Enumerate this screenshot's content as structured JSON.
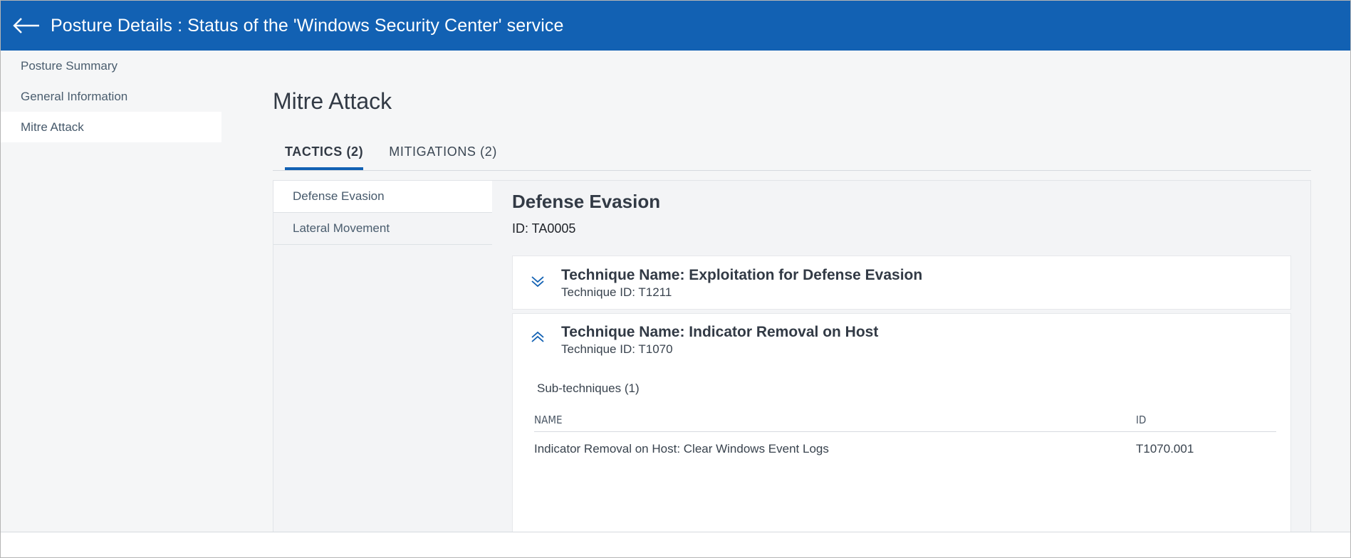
{
  "header": {
    "title": "Posture Details : Status of the 'Windows Security Center' service",
    "back_icon": "arrow-left-icon",
    "bg_color": "#1261b3"
  },
  "sidebar": {
    "items": [
      {
        "label": "Posture Summary"
      },
      {
        "label": "General Information"
      },
      {
        "label": "Mitre Attack"
      }
    ]
  },
  "main": {
    "title": "Mitre Attack",
    "tabs": [
      {
        "label": "TACTICS (2)"
      },
      {
        "label": "MITIGATIONS (2)"
      }
    ],
    "tactics": [
      {
        "label": "Defense Evasion"
      },
      {
        "label": "Lateral Movement"
      }
    ],
    "detail": {
      "title": "Defense Evasion",
      "id_text": "ID: TA0005",
      "techniques": [
        {
          "name": "Technique Name: Exploitation for Defense Evasion",
          "id": "Technique ID: T1211",
          "toggle_icon": "chevron-double-down-icon"
        },
        {
          "name": "Technique Name: Indicator Removal on Host",
          "id": "Technique ID: T1070",
          "toggle_icon": "chevron-double-up-icon",
          "sub_heading": "Sub-techniques (1)",
          "columns": {
            "name": "NAME",
            "id": "ID"
          },
          "rows": [
            {
              "name": "Indicator Removal on Host: Clear Windows Event Logs",
              "id": "T1070.001"
            }
          ]
        }
      ]
    }
  }
}
